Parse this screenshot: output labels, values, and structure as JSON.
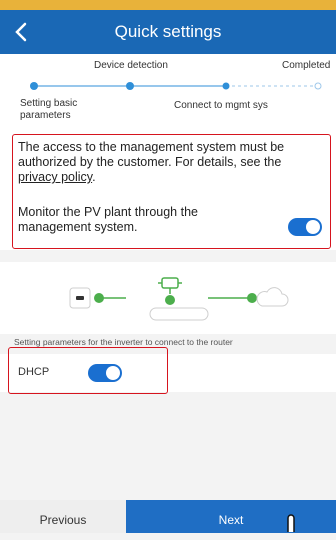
{
  "header": {
    "title": "Quick settings",
    "back_icon": "chevron-left-icon"
  },
  "steps": [
    {
      "label": "Setting basic\nparameters",
      "state": "done"
    },
    {
      "label": "Device detection",
      "state": "done"
    },
    {
      "label": "Connect to mgmt sys",
      "state": "current"
    },
    {
      "label": "Completed",
      "state": "pending"
    }
  ],
  "notice": {
    "text": "The access to the management system must be authorized by the customer. For details, see the ",
    "link": "privacy policy",
    "suffix": "."
  },
  "monitor": {
    "label": "Monitor the PV plant through the management system.",
    "enabled": true
  },
  "diagram": {
    "icons": [
      "inverter-icon",
      "dongle-icon",
      "router-icon",
      "cloud-icon"
    ]
  },
  "caption": "Setting parameters for the inverter to connect to the router",
  "dhcp": {
    "label": "DHCP",
    "enabled": true
  },
  "footer": {
    "previous_label": "Previous",
    "next_label": "Next"
  },
  "colors": {
    "header": "#1a68b5",
    "accent": "#1a6fd0",
    "highlight": "#d6141e",
    "step_done": "#2f8fd8",
    "diagram_green": "#4cae4c"
  }
}
